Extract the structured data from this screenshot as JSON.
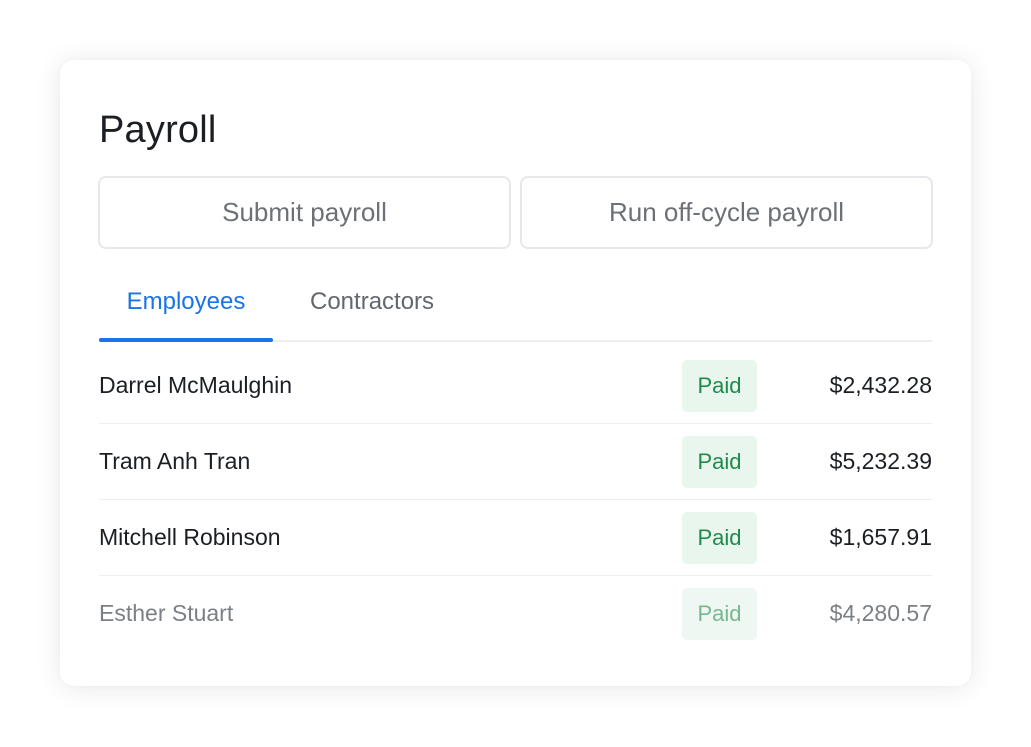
{
  "payroll": {
    "title": "Payroll",
    "actions": {
      "submit_label": "Submit payroll",
      "off_cycle_label": "Run off-cycle payroll"
    },
    "tabs": [
      {
        "label": "Employees",
        "active": true
      },
      {
        "label": "Contractors",
        "active": false
      }
    ],
    "rows": [
      {
        "name": "Darrel McMaulghin",
        "status": "Paid",
        "amount": "$2,432.28"
      },
      {
        "name": "Tram Anh Tran",
        "status": "Paid",
        "amount": "$5,232.39"
      },
      {
        "name": "Mitchell Robinson",
        "status": "Paid",
        "amount": "$1,657.91"
      },
      {
        "name": "Esther Stuart",
        "status": "Paid",
        "amount": "$4,280.57"
      }
    ]
  },
  "colors": {
    "accent": "#1a73e8",
    "paid_badge_bg": "#e8f6ed",
    "paid_badge_text": "#1f8a4c"
  }
}
